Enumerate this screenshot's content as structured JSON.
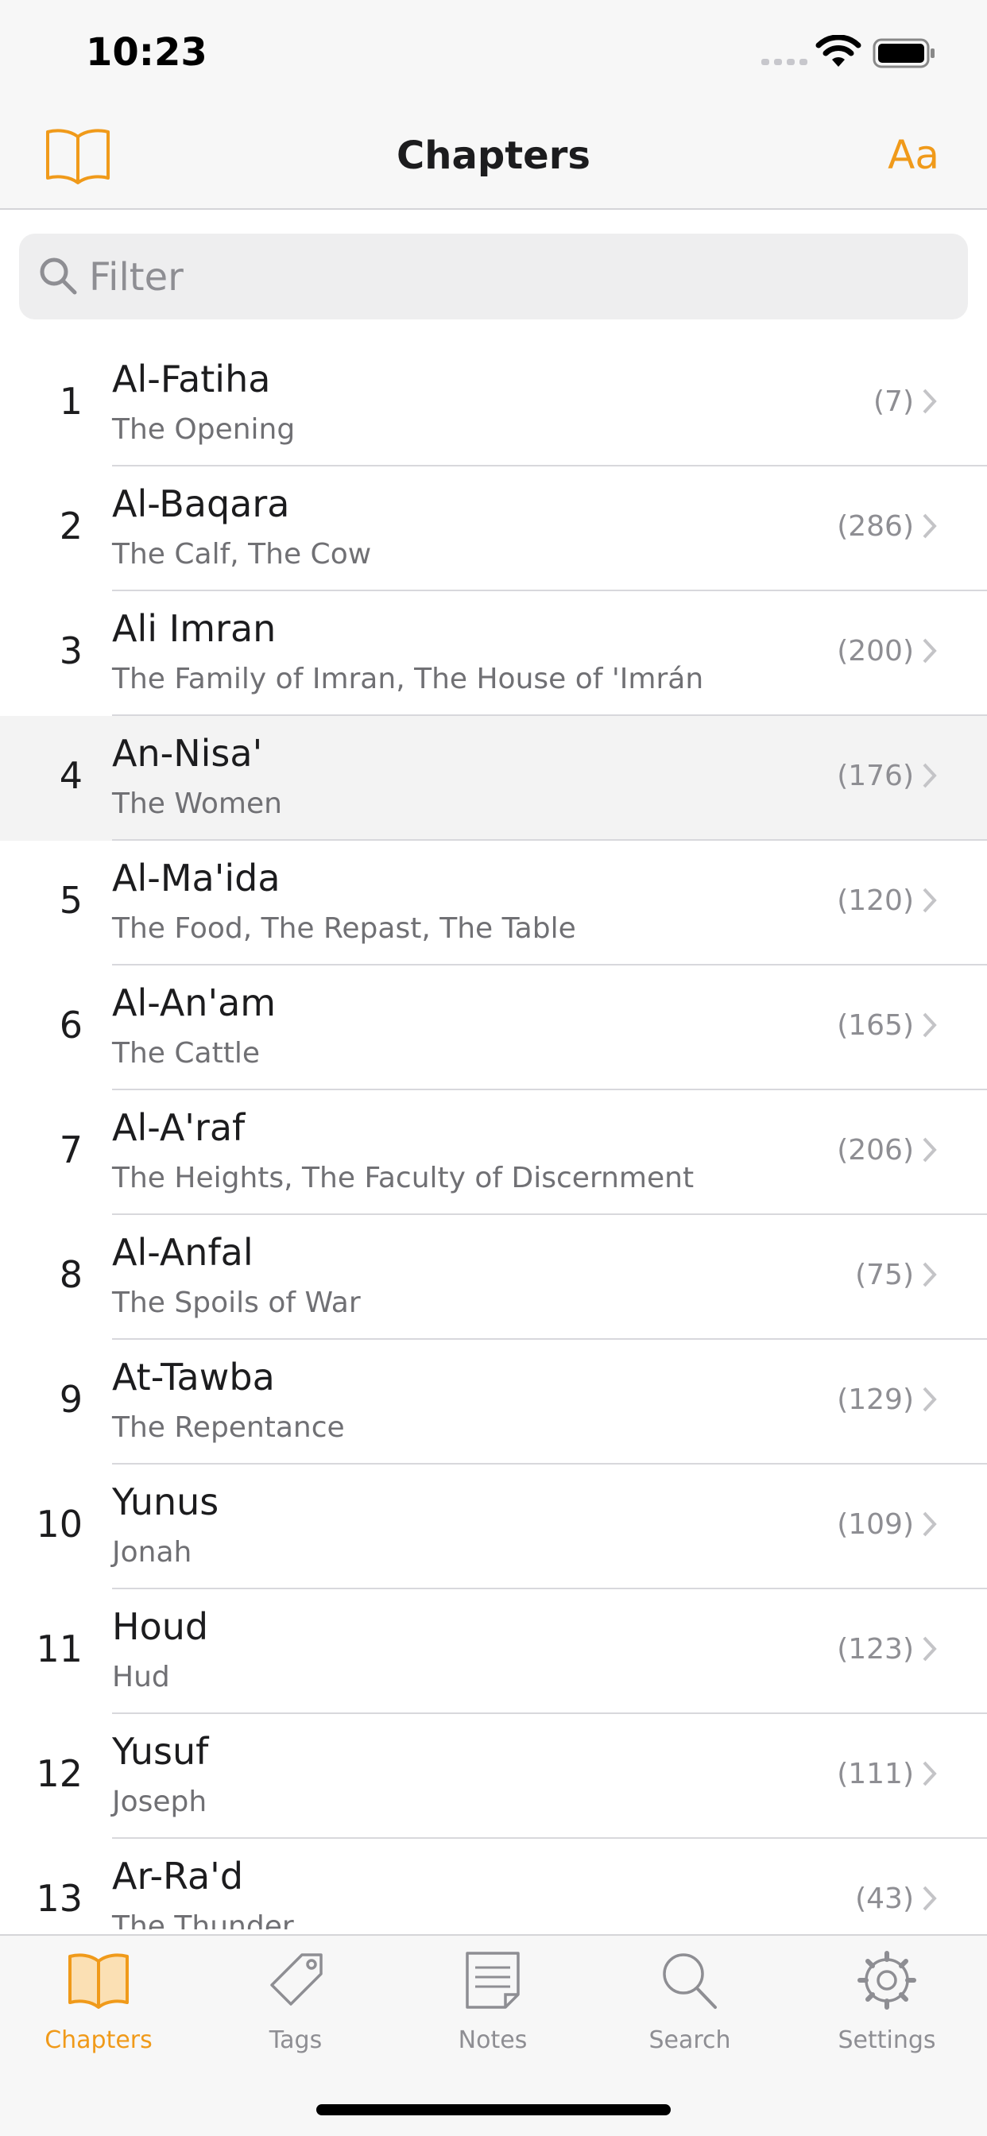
{
  "status_bar": {
    "time": "10:23"
  },
  "nav": {
    "title": "Chapters",
    "font_button": "Aa"
  },
  "search": {
    "placeholder": "Filter"
  },
  "colors": {
    "accent": "#f09a1a",
    "selected_row": "#f3f3f3",
    "secondary_text": "#707074"
  },
  "chapters": [
    {
      "number": "1",
      "name": "Al-Fatiha",
      "subtitle": "The Opening",
      "count": "(7)"
    },
    {
      "number": "2",
      "name": "Al-Baqara",
      "subtitle": "The Calf, The Cow",
      "count": "(286)"
    },
    {
      "number": "3",
      "name": "Ali Imran",
      "subtitle": "The Family of Imran, The House of 'Imrán",
      "count": "(200)"
    },
    {
      "number": "4",
      "name": "An-Nisa'",
      "subtitle": "The Women",
      "count": "(176)",
      "selected": true
    },
    {
      "number": "5",
      "name": "Al-Ma'ida",
      "subtitle": "The Food, The Repast, The Table",
      "count": "(120)"
    },
    {
      "number": "6",
      "name": "Al-An'am",
      "subtitle": "The Cattle",
      "count": "(165)"
    },
    {
      "number": "7",
      "name": "Al-A'raf",
      "subtitle": "The Heights, The Faculty of Discernment",
      "count": "(206)"
    },
    {
      "number": "8",
      "name": "Al-Anfal",
      "subtitle": "The Spoils of War",
      "count": "(75)"
    },
    {
      "number": "9",
      "name": "At-Tawba",
      "subtitle": "The Repentance",
      "count": "(129)"
    },
    {
      "number": "10",
      "name": "Yunus",
      "subtitle": "Jonah",
      "count": "(109)"
    },
    {
      "number": "11",
      "name": "Houd",
      "subtitle": "Hud",
      "count": "(123)"
    },
    {
      "number": "12",
      "name": "Yusuf",
      "subtitle": "Joseph",
      "count": "(111)"
    },
    {
      "number": "13",
      "name": "Ar-Ra'd",
      "subtitle": "The Thunder",
      "count": "(43)"
    }
  ],
  "tabs": [
    {
      "label": "Chapters",
      "icon": "book-icon",
      "active": true
    },
    {
      "label": "Tags",
      "icon": "tag-icon"
    },
    {
      "label": "Notes",
      "icon": "notes-icon"
    },
    {
      "label": "Search",
      "icon": "search-icon"
    },
    {
      "label": "Settings",
      "icon": "gear-icon"
    }
  ]
}
